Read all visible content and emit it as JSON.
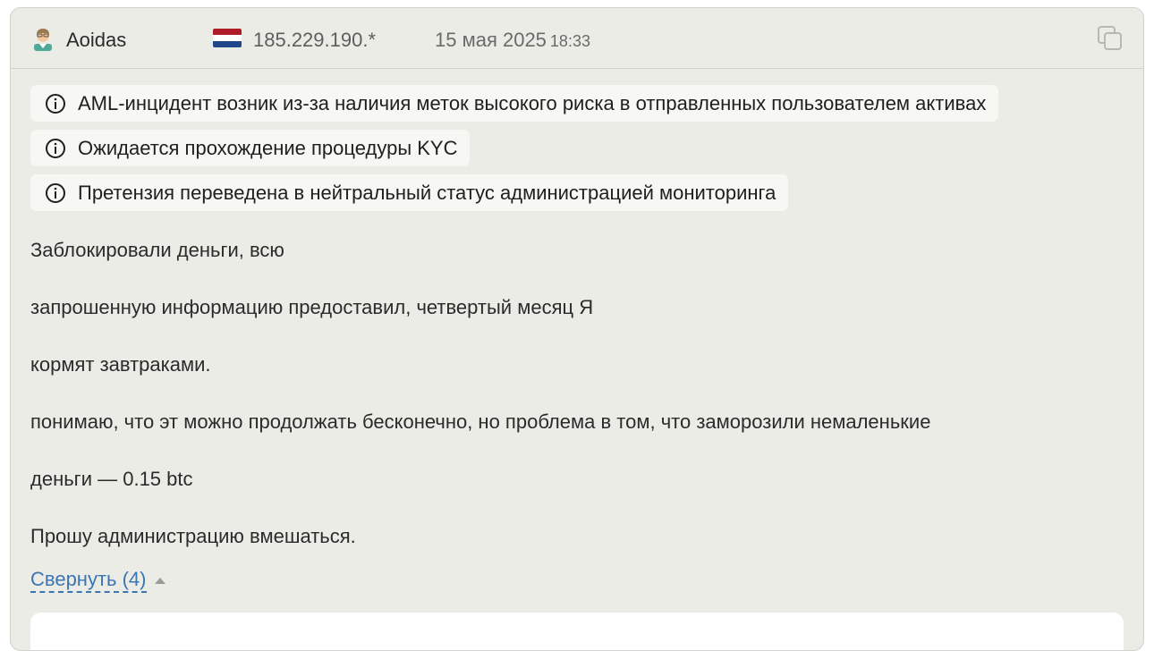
{
  "post": {
    "author": "Aoidas",
    "ip": "185.229.190.*",
    "date": "15 мая 2025",
    "time": "18:33",
    "flag_country": "Netherlands",
    "flag_colors": [
      "#ae1c28",
      "#ffffff",
      "#21468b"
    ],
    "icons": {
      "avatar": "user-avatar-icon",
      "copy": "copy-icon",
      "info": "info-circle-icon",
      "collapse": "triangle-up-icon"
    }
  },
  "tags": [
    {
      "text": "AML-инцидент возник из-за наличия меток высокого риска в отправленных пользователем активах"
    },
    {
      "text": "Ожидается прохождение процедуры KYC"
    },
    {
      "text": "Претензия переведена в нейтральный статус администрацией мониторинга"
    }
  ],
  "body": {
    "paragraphs": [
      "Заблокировали деньги, всю",
      "запрошенную информацию предоставил, четвертый месяц Я",
      "кормят завтраками.",
      "понимаю, что эт можно продолжать бесконечно, но проблема в том, что заморозили немаленькие",
      "деньги — 0.15 btc",
      "Прошу администрацию вмешаться."
    ]
  },
  "collapse": {
    "label": "Свернуть (4)"
  },
  "colors": {
    "card_bg": "#ecece7",
    "tag_bg": "#f7f7f3",
    "link": "#3b76b3"
  }
}
